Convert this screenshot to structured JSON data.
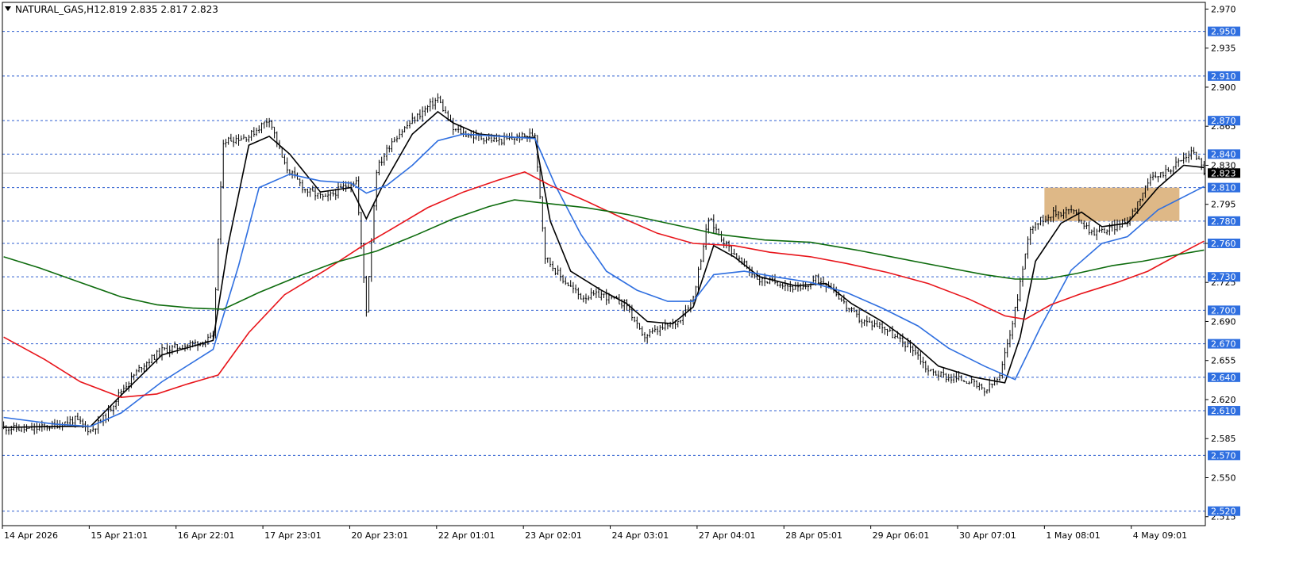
{
  "header": {
    "menu_icon": "triangle-down-icon",
    "symbol": "NATURAL_GAS,H1",
    "ohlc": "2.819 2.835 2.817 2.823"
  },
  "colors": {
    "background": "#ffffff",
    "candles": "#000000",
    "ma_fast": "#000000",
    "ma_medium": "#2f6fe0",
    "ma_slow": "#e8141a",
    "ma_long": "#0d6b0d",
    "level_line": "#2f5fd0",
    "level_label_bg": "#2f6fe0",
    "price_label_bg": "#000000",
    "zone": "#deb887"
  },
  "chart_data": {
    "type": "candlestick",
    "symbol": "NATURAL_GAS",
    "timeframe": "H1",
    "ylim": [
      2.507,
      2.976
    ],
    "y_ticks": [
      "2.970",
      "2.935",
      "2.900",
      "2.865",
      "2.830",
      "2.795",
      "2.760",
      "2.725",
      "2.690",
      "2.655",
      "2.620",
      "2.585",
      "2.550",
      "2.515"
    ],
    "level_labels": [
      "2.950",
      "2.910",
      "2.870",
      "2.840",
      "2.810",
      "2.780",
      "2.760",
      "2.730",
      "2.700",
      "2.670",
      "2.640",
      "2.610",
      "2.570",
      "2.520"
    ],
    "current_price": "2.823",
    "x_labels": [
      "14 Apr 2026",
      "15 Apr 21:01",
      "16 Apr 22:01",
      "17 Apr 23:01",
      "20 Apr 23:01",
      "22 Apr 01:01",
      "23 Apr 02:01",
      "24 Apr 03:01",
      "27 Apr 04:01",
      "28 Apr 05:01",
      "29 Apr 06:01",
      "30 Apr 07:01",
      "1 May 08:01",
      "4 May 09:01"
    ],
    "zone": {
      "from": 2.78,
      "to": 2.81,
      "start_label": "1 May 08:01"
    },
    "close_path": [
      [
        0,
        2.595
      ],
      [
        10,
        2.593
      ],
      [
        20,
        2.597
      ],
      [
        28,
        2.602
      ],
      [
        34,
        2.592
      ],
      [
        40,
        2.605
      ],
      [
        46,
        2.628
      ],
      [
        54,
        2.65
      ],
      [
        62,
        2.664
      ],
      [
        70,
        2.668
      ],
      [
        78,
        2.672
      ],
      [
        82,
        2.675
      ],
      [
        86,
        2.852
      ],
      [
        96,
        2.856
      ],
      [
        104,
        2.872
      ],
      [
        110,
        2.83
      ],
      [
        118,
        2.808
      ],
      [
        126,
        2.8
      ],
      [
        134,
        2.812
      ],
      [
        138,
        2.816
      ],
      [
        142,
        2.7
      ],
      [
        146,
        2.826
      ],
      [
        152,
        2.852
      ],
      [
        160,
        2.87
      ],
      [
        170,
        2.89
      ],
      [
        176,
        2.862
      ],
      [
        184,
        2.856
      ],
      [
        194,
        2.852
      ],
      [
        202,
        2.855
      ],
      [
        208,
        2.858
      ],
      [
        212,
        2.748
      ],
      [
        218,
        2.73
      ],
      [
        226,
        2.712
      ],
      [
        234,
        2.714
      ],
      [
        244,
        2.705
      ],
      [
        250,
        2.676
      ],
      [
        256,
        2.682
      ],
      [
        264,
        2.69
      ],
      [
        270,
        2.712
      ],
      [
        276,
        2.782
      ],
      [
        282,
        2.762
      ],
      [
        288,
        2.745
      ],
      [
        296,
        2.727
      ],
      [
        304,
        2.725
      ],
      [
        312,
        2.718
      ],
      [
        318,
        2.728
      ],
      [
        324,
        2.722
      ],
      [
        330,
        2.703
      ],
      [
        336,
        2.69
      ],
      [
        344,
        2.686
      ],
      [
        350,
        2.674
      ],
      [
        356,
        2.666
      ],
      [
        362,
        2.646
      ],
      [
        370,
        2.64
      ],
      [
        378,
        2.637
      ],
      [
        384,
        2.627
      ],
      [
        390,
        2.64
      ],
      [
        396,
        2.7
      ],
      [
        402,
        2.775
      ],
      [
        410,
        2.786
      ],
      [
        418,
        2.79
      ],
      [
        426,
        2.77
      ],
      [
        432,
        2.772
      ],
      [
        440,
        2.78
      ],
      [
        448,
        2.815
      ],
      [
        456,
        2.826
      ],
      [
        466,
        2.843
      ],
      [
        470,
        2.825
      ]
    ],
    "series": [
      {
        "name": "",
        "color": "#000000",
        "points": [
          [
            0,
            2.595
          ],
          [
            20,
            2.596
          ],
          [
            34,
            2.596
          ],
          [
            46,
            2.624
          ],
          [
            62,
            2.66
          ],
          [
            82,
            2.673
          ],
          [
            88,
            2.76
          ],
          [
            96,
            2.848
          ],
          [
            104,
            2.856
          ],
          [
            112,
            2.84
          ],
          [
            124,
            2.806
          ],
          [
            136,
            2.81
          ],
          [
            142,
            2.782
          ],
          [
            148,
            2.81
          ],
          [
            160,
            2.858
          ],
          [
            170,
            2.878
          ],
          [
            176,
            2.868
          ],
          [
            186,
            2.858
          ],
          [
            200,
            2.855
          ],
          [
            208,
            2.855
          ],
          [
            214,
            2.78
          ],
          [
            222,
            2.735
          ],
          [
            234,
            2.718
          ],
          [
            244,
            2.706
          ],
          [
            252,
            2.69
          ],
          [
            262,
            2.688
          ],
          [
            270,
            2.703
          ],
          [
            278,
            2.758
          ],
          [
            286,
            2.748
          ],
          [
            296,
            2.73
          ],
          [
            310,
            2.722
          ],
          [
            322,
            2.724
          ],
          [
            332,
            2.706
          ],
          [
            344,
            2.69
          ],
          [
            356,
            2.67
          ],
          [
            366,
            2.65
          ],
          [
            380,
            2.64
          ],
          [
            392,
            2.635
          ],
          [
            398,
            2.676
          ],
          [
            404,
            2.744
          ],
          [
            414,
            2.778
          ],
          [
            422,
            2.788
          ],
          [
            430,
            2.775
          ],
          [
            440,
            2.778
          ],
          [
            452,
            2.81
          ],
          [
            462,
            2.83
          ],
          [
            470,
            2.828
          ]
        ]
      },
      {
        "name": "",
        "color": "#2f6fe0",
        "points": [
          [
            0,
            2.604
          ],
          [
            20,
            2.598
          ],
          [
            34,
            2.596
          ],
          [
            46,
            2.608
          ],
          [
            62,
            2.636
          ],
          [
            82,
            2.665
          ],
          [
            92,
            2.74
          ],
          [
            100,
            2.81
          ],
          [
            112,
            2.822
          ],
          [
            124,
            2.816
          ],
          [
            136,
            2.814
          ],
          [
            142,
            2.805
          ],
          [
            150,
            2.812
          ],
          [
            160,
            2.83
          ],
          [
            170,
            2.852
          ],
          [
            180,
            2.858
          ],
          [
            194,
            2.856
          ],
          [
            208,
            2.854
          ],
          [
            216,
            2.812
          ],
          [
            226,
            2.768
          ],
          [
            236,
            2.735
          ],
          [
            248,
            2.718
          ],
          [
            260,
            2.708
          ],
          [
            270,
            2.708
          ],
          [
            278,
            2.732
          ],
          [
            290,
            2.735
          ],
          [
            302,
            2.73
          ],
          [
            316,
            2.725
          ],
          [
            330,
            2.716
          ],
          [
            344,
            2.702
          ],
          [
            358,
            2.686
          ],
          [
            370,
            2.666
          ],
          [
            384,
            2.65
          ],
          [
            396,
            2.638
          ],
          [
            406,
            2.685
          ],
          [
            418,
            2.736
          ],
          [
            430,
            2.76
          ],
          [
            440,
            2.766
          ],
          [
            452,
            2.79
          ],
          [
            470,
            2.811
          ]
        ]
      },
      {
        "name": "",
        "color": "#e8141a",
        "points": [
          [
            0,
            2.676
          ],
          [
            16,
            2.656
          ],
          [
            30,
            2.636
          ],
          [
            46,
            2.622
          ],
          [
            60,
            2.625
          ],
          [
            72,
            2.634
          ],
          [
            84,
            2.642
          ],
          [
            96,
            2.68
          ],
          [
            110,
            2.714
          ],
          [
            126,
            2.736
          ],
          [
            140,
            2.757
          ],
          [
            152,
            2.773
          ],
          [
            166,
            2.792
          ],
          [
            180,
            2.806
          ],
          [
            194,
            2.817
          ],
          [
            204,
            2.824
          ],
          [
            214,
            2.812
          ],
          [
            228,
            2.798
          ],
          [
            242,
            2.783
          ],
          [
            256,
            2.769
          ],
          [
            270,
            2.76
          ],
          [
            286,
            2.758
          ],
          [
            300,
            2.752
          ],
          [
            316,
            2.748
          ],
          [
            330,
            2.742
          ],
          [
            346,
            2.734
          ],
          [
            362,
            2.724
          ],
          [
            378,
            2.71
          ],
          [
            392,
            2.695
          ],
          [
            400,
            2.692
          ],
          [
            410,
            2.705
          ],
          [
            422,
            2.715
          ],
          [
            436,
            2.725
          ],
          [
            448,
            2.735
          ],
          [
            460,
            2.75
          ],
          [
            470,
            2.762
          ]
        ]
      },
      {
        "name": "",
        "color": "#0d6b0d",
        "points": [
          [
            0,
            2.748
          ],
          [
            14,
            2.738
          ],
          [
            30,
            2.725
          ],
          [
            46,
            2.712
          ],
          [
            60,
            2.705
          ],
          [
            74,
            2.702
          ],
          [
            86,
            2.701
          ],
          [
            100,
            2.716
          ],
          [
            116,
            2.731
          ],
          [
            130,
            2.743
          ],
          [
            146,
            2.753
          ],
          [
            162,
            2.768
          ],
          [
            176,
            2.782
          ],
          [
            190,
            2.793
          ],
          [
            200,
            2.799
          ],
          [
            212,
            2.796
          ],
          [
            228,
            2.792
          ],
          [
            244,
            2.786
          ],
          [
            262,
            2.777
          ],
          [
            280,
            2.768
          ],
          [
            298,
            2.763
          ],
          [
            316,
            2.761
          ],
          [
            334,
            2.754
          ],
          [
            352,
            2.746
          ],
          [
            370,
            2.738
          ],
          [
            384,
            2.732
          ],
          [
            396,
            2.728
          ],
          [
            408,
            2.728
          ],
          [
            420,
            2.733
          ],
          [
            434,
            2.74
          ],
          [
            446,
            2.744
          ],
          [
            460,
            2.75
          ],
          [
            470,
            2.754
          ]
        ]
      }
    ]
  }
}
